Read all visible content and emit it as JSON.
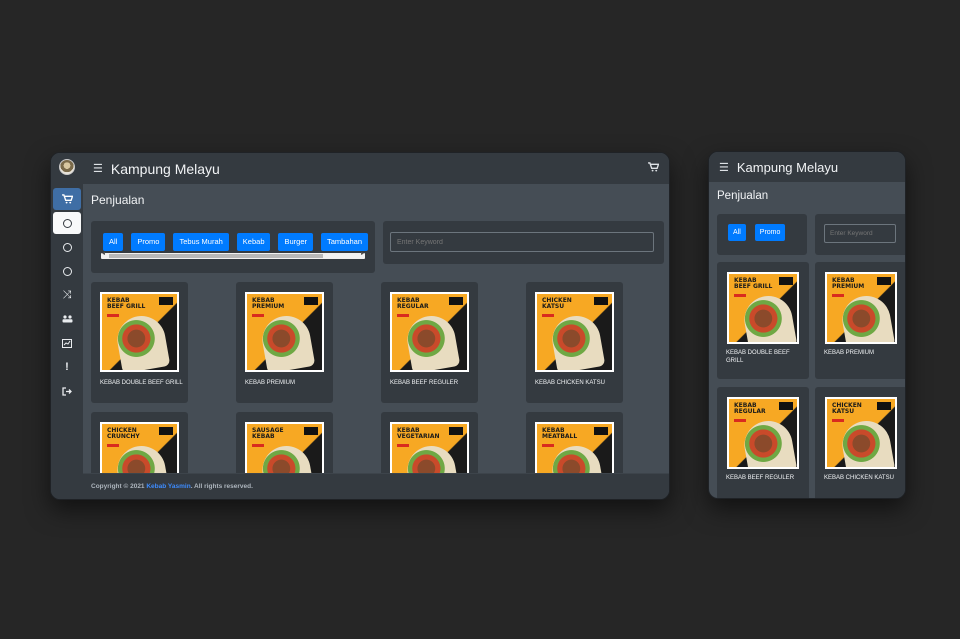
{
  "desktop": {
    "brand": "Kampung Melayu",
    "page_title": "Penjualan",
    "categories": [
      "All",
      "Promo",
      "Tebus Murah",
      "Kebab",
      "Burger",
      "Tambahan"
    ],
    "search_placeholder": "Enter Keyword",
    "products": [
      {
        "label": "KEBAB DOUBLE BEEF GRILL",
        "poster": "KEBAB\nBEEF GRILL"
      },
      {
        "label": "KEBAB PREMIUM",
        "poster": "KEBAB\nPREMIUM"
      },
      {
        "label": "KEBAB BEEF REGULER",
        "poster": "KEBAB\nREGULAR"
      },
      {
        "label": "KEBAB CHICKEN KATSU",
        "poster": "CHICKEN\nKATSU"
      },
      {
        "label": "",
        "poster": "CHICKEN\nCRUNCHY"
      },
      {
        "label": "",
        "poster": "SAUSAGE\nKEBAB"
      },
      {
        "label": "",
        "poster": "KEBAB\nVEGETARIAN"
      },
      {
        "label": "",
        "poster": "KEBAB\nMEATBALL"
      }
    ],
    "footer": {
      "prefix": "Copyright © 2021 ",
      "link": "Kebab Yasmin",
      "suffix": ". All rights reserved."
    }
  },
  "mobile": {
    "brand": "Kampung Melayu",
    "page_title": "Penjualan",
    "categories": [
      "All",
      "Promo"
    ],
    "search_placeholder": "Enter Keyword",
    "products": [
      {
        "label": "KEBAB DOUBLE BEEF GRILL",
        "poster": "KEBAB\nBEEF GRILL"
      },
      {
        "label": "KEBAB PREMIUM",
        "poster": "KEBAB\nPREMIUM"
      },
      {
        "label": "KEBAB BEEF REGULER",
        "poster": "KEBAB\nREGULAR"
      },
      {
        "label": "KEBAB CHICKEN KATSU",
        "poster": "CHICKEN\nKATSU"
      }
    ]
  },
  "sidebar_icons": [
    "cart-icon",
    "circle-icon",
    "circle-icon",
    "circle-icon",
    "shuffle-icon",
    "users-icon",
    "report-icon",
    "alert-icon",
    "logout-icon"
  ],
  "colors": {
    "accent": "#007bff",
    "sidebar_active": "#3f6ea5",
    "background": "#262626",
    "panel": "#343a40",
    "content": "#454d55"
  }
}
